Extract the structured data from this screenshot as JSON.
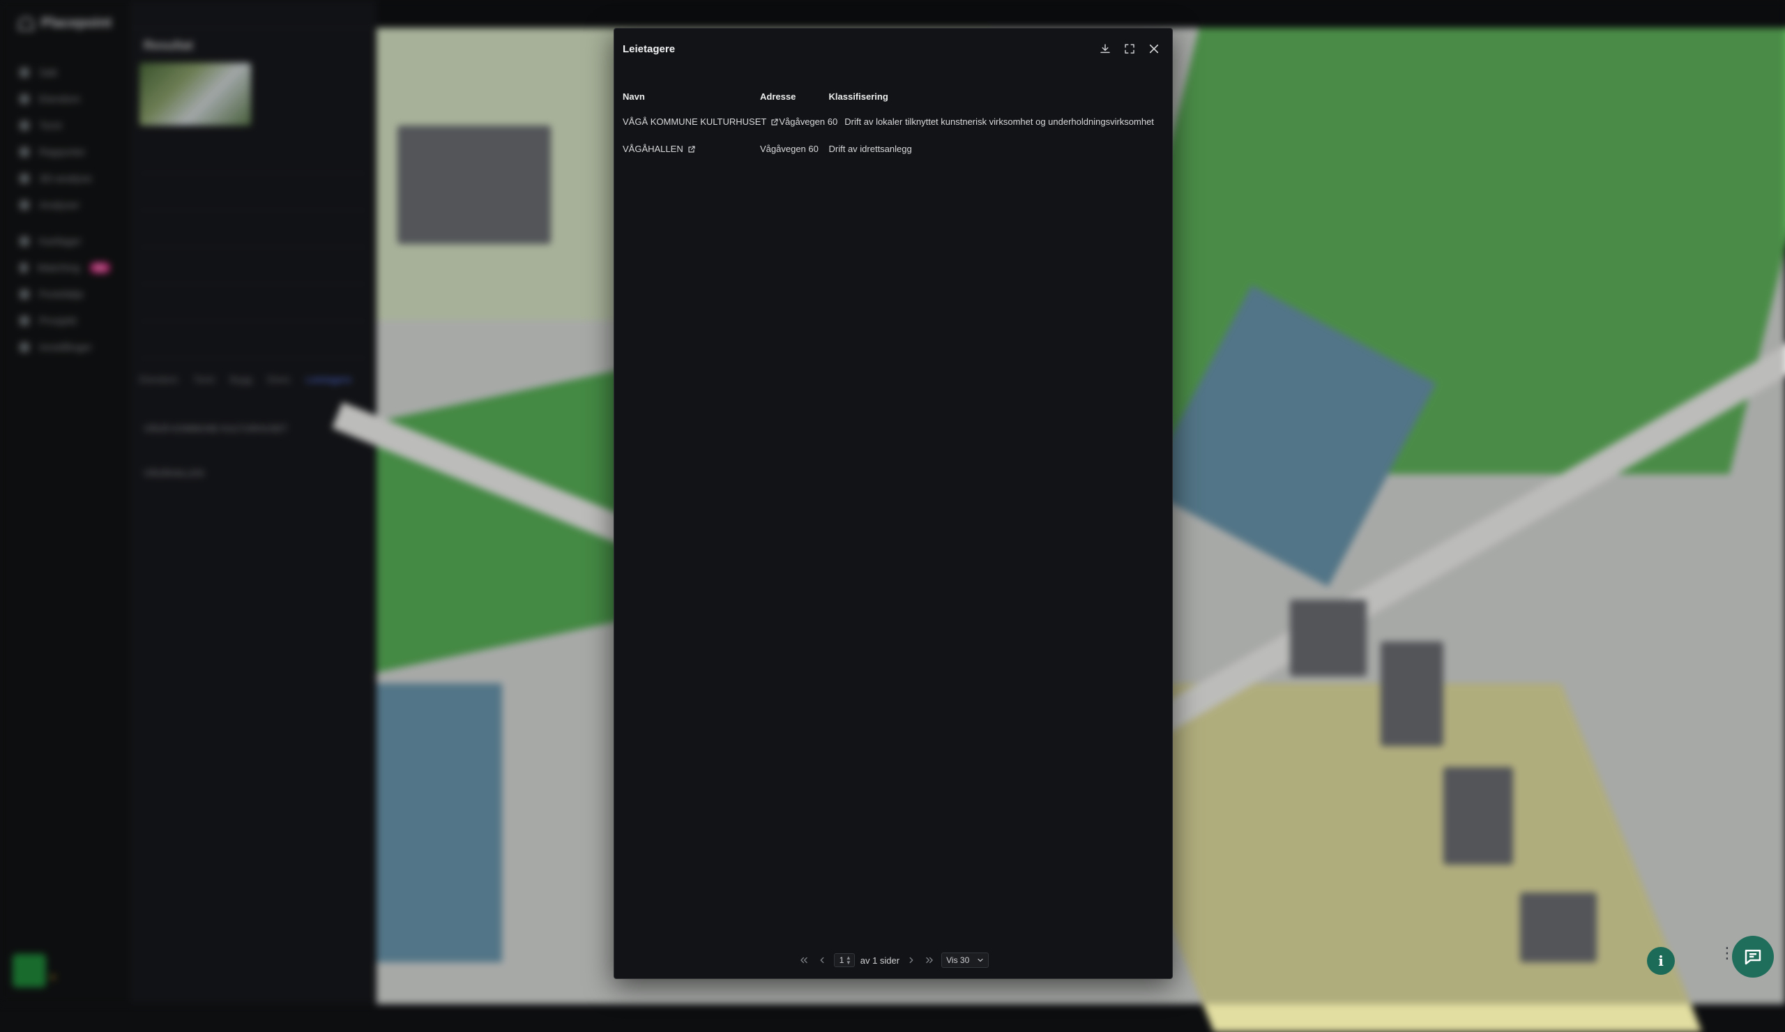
{
  "background": {
    "app_name": "Placepoint",
    "nav": [
      "Søk",
      "Eiendom",
      "Tomt",
      "Rapporter",
      "3D-analyse",
      "Analyser",
      "Kartlager",
      "Matching",
      "Portefølje",
      "Prosjekt",
      "Innstillinger"
    ],
    "nav_badge": "Ny",
    "panel_title": "Resultat",
    "panel_tabs": [
      "Eiendom",
      "Tomt",
      "Bygg",
      "Eiere",
      "Leietagere"
    ],
    "panel_list": [
      "VÅGÅ KOMMUNE KULTURHUSET",
      "VÅGÅHALLEN"
    ]
  },
  "modal": {
    "title": "Leietagere",
    "actions": {
      "download": "download-icon",
      "fullscreen": "expand-icon",
      "close": "close-icon"
    },
    "columns": {
      "name": "Navn",
      "address": "Adresse",
      "classification": "Klassifisering"
    },
    "rows": [
      {
        "name": "VÅGÅ KOMMUNE KULTURHUSET",
        "address": "Vågåvegen 60",
        "classification": "Drift av lokaler tilknyttet kunstnerisk virksomhet og underholdningsvirksomhet"
      },
      {
        "name": "VÅGÅHALLEN",
        "address": "Vågåvegen 60",
        "classification": "Drift av idrettsanlegg"
      }
    ],
    "pager": {
      "page": "1",
      "of_label": "av 1 sider",
      "page_size_label": "Vis 30"
    }
  },
  "colors": {
    "accent": "#1f6e5b",
    "modal_bg": "#121316"
  }
}
